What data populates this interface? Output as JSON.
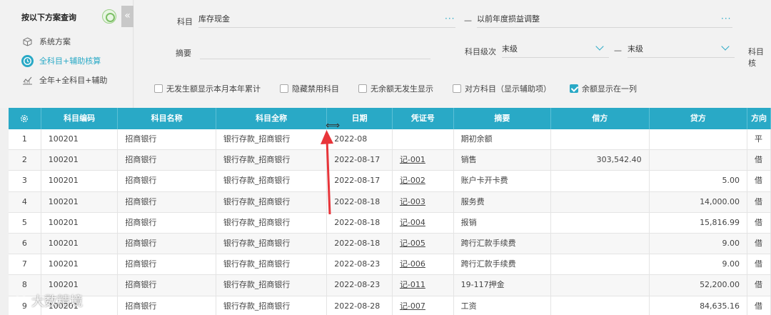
{
  "left_panel": {
    "title": "按以下方案查询",
    "collapse_glyph": "«",
    "schemes": [
      {
        "label": "系统方案",
        "icon": "cube-icon",
        "active": false
      },
      {
        "label": "全科目+辅助核算",
        "icon": "clock-icon",
        "active": true
      },
      {
        "label": "全年+全科目+辅助",
        "icon": "chart-icon",
        "active": false
      }
    ]
  },
  "filter": {
    "subject_label": "科目",
    "subject_from": "库存现金",
    "subject_to": "以前年度损益调整",
    "dash": "—",
    "dots": "···",
    "summary_label": "摘要",
    "summary_value": "",
    "level_label": "科目级次",
    "level_from": "末级",
    "level_to": "末级",
    "extra_label": "科目核",
    "checkboxes": [
      {
        "label": "无发生额显示本月本年累计",
        "checked": false
      },
      {
        "label": "隐藏禁用科目",
        "checked": false
      },
      {
        "label": "无余额无发生显示",
        "checked": false
      },
      {
        "label": "对方科目（显示辅助项）",
        "checked": false
      },
      {
        "label": "余额显示在一列",
        "checked": true
      }
    ]
  },
  "table": {
    "headers": [
      "科目编码",
      "科目名称",
      "科目全称",
      "日期",
      "凭证号",
      "摘要",
      "借方",
      "贷方",
      "方向"
    ],
    "rows": [
      {
        "no": "1",
        "code": "100201",
        "name": "招商银行",
        "full": "银行存款_招商银行",
        "date": "2022-08",
        "voucher": "",
        "summary": "期初余额",
        "debit": "",
        "credit": "",
        "dir": "平"
      },
      {
        "no": "2",
        "code": "100201",
        "name": "招商银行",
        "full": "银行存款_招商银行",
        "date": "2022-08-17",
        "voucher": "记-001",
        "summary": "销售",
        "debit": "303,542.40",
        "credit": "",
        "dir": "借"
      },
      {
        "no": "3",
        "code": "100201",
        "name": "招商银行",
        "full": "银行存款_招商银行",
        "date": "2022-08-17",
        "voucher": "记-002",
        "summary": "账户卡开卡费",
        "debit": "",
        "credit": "5.00",
        "dir": "借"
      },
      {
        "no": "4",
        "code": "100201",
        "name": "招商银行",
        "full": "银行存款_招商银行",
        "date": "2022-08-18",
        "voucher": "记-003",
        "summary": "服务费",
        "debit": "",
        "credit": "14,000.00",
        "dir": "借"
      },
      {
        "no": "5",
        "code": "100201",
        "name": "招商银行",
        "full": "银行存款_招商银行",
        "date": "2022-08-18",
        "voucher": "记-004",
        "summary": "报销",
        "debit": "",
        "credit": "15,816.99",
        "dir": "借"
      },
      {
        "no": "6",
        "code": "100201",
        "name": "招商银行",
        "full": "银行存款_招商银行",
        "date": "2022-08-18",
        "voucher": "记-005",
        "summary": "跨行汇款手续费",
        "debit": "",
        "credit": "9.00",
        "dir": "借"
      },
      {
        "no": "7",
        "code": "100201",
        "name": "招商银行",
        "full": "银行存款_招商银行",
        "date": "2022-08-23",
        "voucher": "记-006",
        "summary": "跨行汇款手续费",
        "debit": "",
        "credit": "9.00",
        "dir": "借"
      },
      {
        "no": "8",
        "code": "100201",
        "name": "招商银行",
        "full": "银行存款_招商银行",
        "date": "2022-08-23",
        "voucher": "记-011",
        "summary": "19-117押金",
        "debit": "",
        "credit": "52,200.00",
        "dir": "借"
      },
      {
        "no": "9",
        "code": "100201",
        "name": "招商银行",
        "full": "银行存款_招商银行",
        "date": "2022-08-28",
        "voucher": "记-007",
        "summary": "工资",
        "debit": "",
        "credit": "84,635.16",
        "dir": "借"
      }
    ]
  },
  "cursor_glyph": "⟺",
  "watermark": "大数精境",
  "colors": {
    "accent": "#29a9c6",
    "arrow": "#e8353a",
    "header_bg": "#29a9c6"
  }
}
